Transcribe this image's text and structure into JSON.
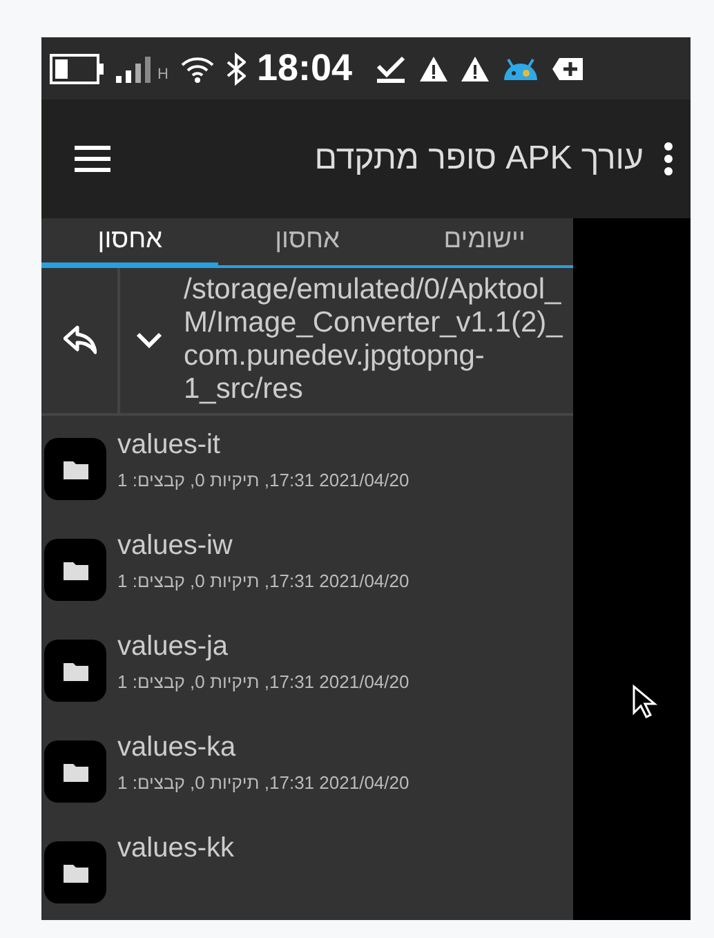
{
  "status_bar": {
    "time": "18:04",
    "network": "H"
  },
  "app_bar": {
    "title": "עורך APK סופר מתקדם"
  },
  "tabs": [
    {
      "label": "יישומים",
      "selected": false
    },
    {
      "label": "אחסון",
      "selected": false
    },
    {
      "label": "אחסון",
      "selected": true
    }
  ],
  "path": "/storage/emulated/0/Apktool_M/Image_Converter_v1.1(2)_com.punedev.jpgtopng-1_src/res",
  "files": [
    {
      "name": "values-it",
      "meta": "2021/04/20 17:31, תיקיות 0, קבצים: 1"
    },
    {
      "name": "values-iw",
      "meta": "2021/04/20 17:31, תיקיות 0, קבצים: 1"
    },
    {
      "name": "values-ja",
      "meta": "2021/04/20 17:31, תיקיות 0, קבצים: 1"
    },
    {
      "name": "values-ka",
      "meta": "2021/04/20 17:31, תיקיות 0, קבצים: 1"
    },
    {
      "name": "values-kk"
    }
  ]
}
